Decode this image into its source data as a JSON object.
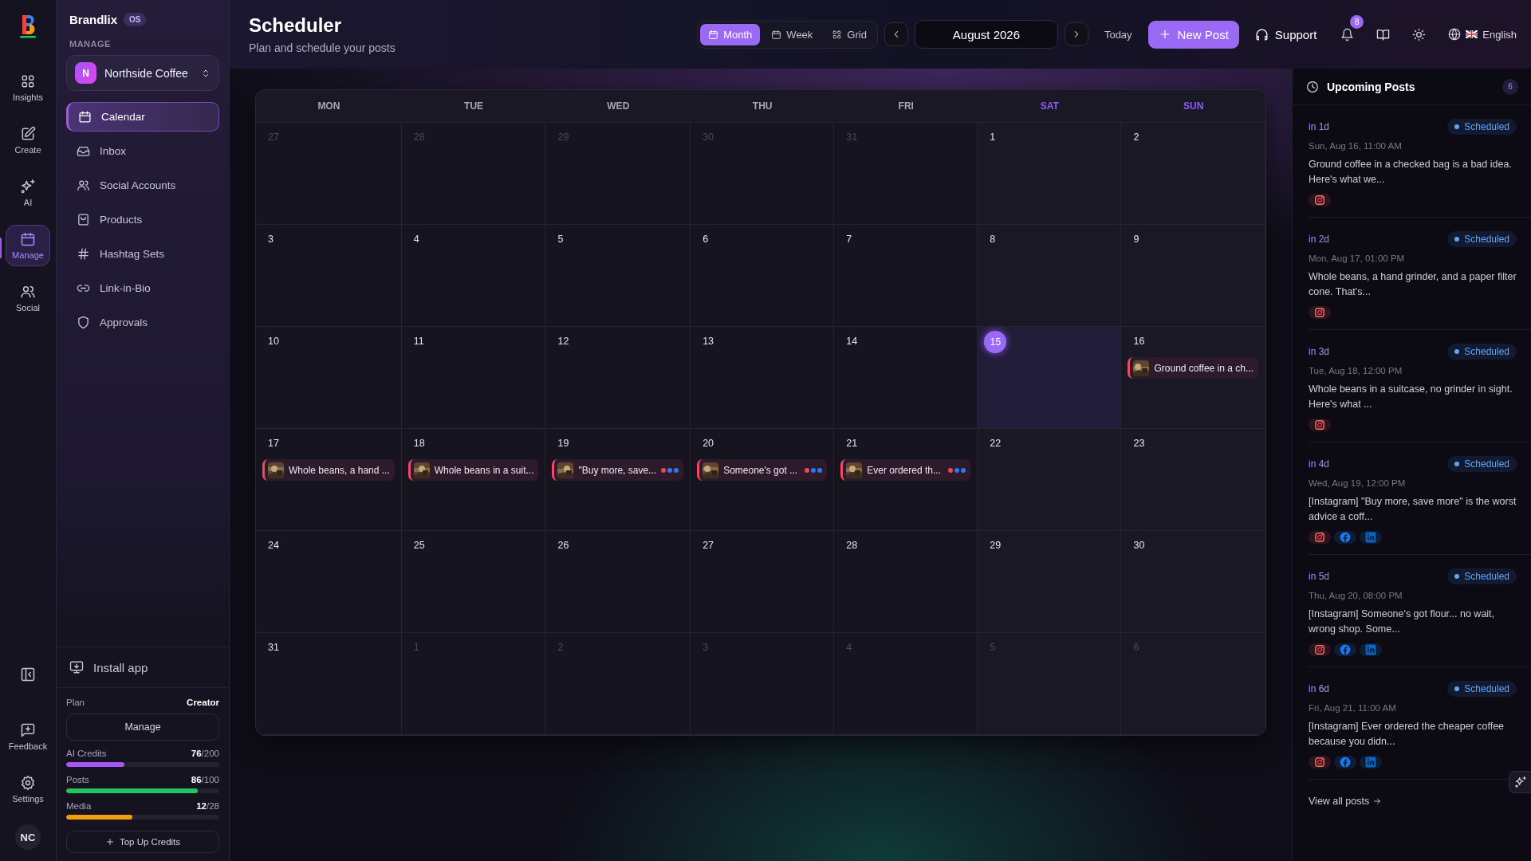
{
  "rail": {
    "items": [
      {
        "label": "Insights",
        "selected": false
      },
      {
        "label": "Create",
        "selected": false
      },
      {
        "label": "AI",
        "selected": false
      },
      {
        "label": "Manage",
        "selected": true
      },
      {
        "label": "Social",
        "selected": false
      }
    ],
    "footer": [
      {
        "label": "Feedback"
      },
      {
        "label": "Settings"
      }
    ],
    "avatar": "NC"
  },
  "sidebar": {
    "brand": "Brandlix",
    "brand_badge": "OS",
    "section": "MANAGE",
    "workspace": {
      "initial": "N",
      "name": "Northside Coffee"
    },
    "items": [
      {
        "label": "Calendar",
        "selected": true
      },
      {
        "label": "Inbox",
        "selected": false
      },
      {
        "label": "Social Accounts",
        "selected": false
      },
      {
        "label": "Products",
        "selected": false
      },
      {
        "label": "Hashtag Sets",
        "selected": false
      },
      {
        "label": "Link-in-Bio",
        "selected": false
      },
      {
        "label": "Approvals",
        "selected": false
      }
    ],
    "install": "Install app",
    "plan_label": "Plan",
    "plan": "Creator",
    "manage_button": "Manage",
    "usage": [
      {
        "label": "AI Credits",
        "reading": "**76**/200",
        "level": 0.38,
        "color": "#a855f7"
      },
      {
        "label": "Posts",
        "reading": "**86**/100",
        "level": 0.86,
        "color": "#22c55e"
      },
      {
        "label": "Media",
        "reading": "**12**/28",
        "level": 0.43,
        "color": "#f59e0b"
      }
    ],
    "top_up": "Top Up Credits"
  },
  "header": {
    "title": "Scheduler",
    "subtitle": "Plan and schedule your posts",
    "views": [
      {
        "label": "Month",
        "selected": true
      },
      {
        "label": "Week",
        "selected": false
      },
      {
        "label": "Grid",
        "selected": false
      }
    ],
    "period": "August 2026",
    "today": "Today",
    "new_post": "New Post",
    "support": "Support",
    "notifications": "8",
    "language": "English"
  },
  "calendar": {
    "weekdays": [
      {
        "label": "MON",
        "weekend": false
      },
      {
        "label": "TUE",
        "weekend": false
      },
      {
        "label": "WED",
        "weekend": false
      },
      {
        "label": "THU",
        "weekend": false
      },
      {
        "label": "FRI",
        "weekend": false
      },
      {
        "label": "SAT",
        "weekend": true
      },
      {
        "label": "SUN",
        "weekend": true
      }
    ],
    "weeks": [
      [
        {
          "day": "27",
          "in_month": false
        },
        {
          "day": "28",
          "in_month": false
        },
        {
          "day": "29",
          "in_month": false
        },
        {
          "day": "30",
          "in_month": false
        },
        {
          "day": "31",
          "in_month": false
        },
        {
          "day": "1",
          "in_month": true
        },
        {
          "day": "2",
          "in_month": true
        }
      ],
      [
        {
          "day": "3",
          "in_month": true
        },
        {
          "day": "4",
          "in_month": true
        },
        {
          "day": "5",
          "in_month": true
        },
        {
          "day": "6",
          "in_month": true
        },
        {
          "day": "7",
          "in_month": true
        },
        {
          "day": "8",
          "in_month": true
        },
        {
          "day": "9",
          "in_month": true
        }
      ],
      [
        {
          "day": "10",
          "in_month": true
        },
        {
          "day": "11",
          "in_month": true
        },
        {
          "day": "12",
          "in_month": true
        },
        {
          "day": "13",
          "in_month": true
        },
        {
          "day": "14",
          "in_month": true
        },
        {
          "day": "15",
          "in_month": true,
          "today": true
        },
        {
          "day": "16",
          "in_month": true,
          "posts": [
            {
              "text": "Ground coffee in a ch..."
            }
          ]
        }
      ],
      [
        {
          "day": "17",
          "in_month": true,
          "posts": [
            {
              "text": "Whole beans, a hand ..."
            }
          ]
        },
        {
          "day": "18",
          "in_month": true,
          "posts": [
            {
              "text": "Whole beans in a suit..."
            }
          ]
        },
        {
          "day": "19",
          "in_month": true,
          "posts": [
            {
              "text": "\"Buy more, save...",
              "dots": [
                {
                  "color": "#f0445a"
                },
                {
                  "color": "#2b7bf0"
                },
                {
                  "color": "#2b7bf0"
                }
              ]
            }
          ]
        },
        {
          "day": "20",
          "in_month": true,
          "posts": [
            {
              "text": "Someone's got ...",
              "dots": [
                {
                  "color": "#f0445a"
                },
                {
                  "color": "#2b7bf0"
                },
                {
                  "color": "#2b7bf0"
                }
              ]
            }
          ]
        },
        {
          "day": "21",
          "in_month": true,
          "posts": [
            {
              "text": "Ever ordered th...",
              "dots": [
                {
                  "color": "#f0445a"
                },
                {
                  "color": "#2b7bf0"
                },
                {
                  "color": "#2b7bf0"
                }
              ]
            }
          ]
        },
        {
          "day": "22",
          "in_month": true
        },
        {
          "day": "23",
          "in_month": true
        }
      ],
      [
        {
          "day": "24",
          "in_month": true
        },
        {
          "day": "25",
          "in_month": true
        },
        {
          "day": "26",
          "in_month": true
        },
        {
          "day": "27",
          "in_month": true
        },
        {
          "day": "28",
          "in_month": true
        },
        {
          "day": "29",
          "in_month": true
        },
        {
          "day": "30",
          "in_month": true
        }
      ],
      [
        {
          "day": "31",
          "in_month": true
        },
        {
          "day": "1",
          "in_month": false
        },
        {
          "day": "2",
          "in_month": false
        },
        {
          "day": "3",
          "in_month": false
        },
        {
          "day": "4",
          "in_month": false
        },
        {
          "day": "5",
          "in_month": false
        },
        {
          "day": "6",
          "in_month": false
        }
      ]
    ]
  },
  "upcoming": {
    "title": "Upcoming Posts",
    "count": "6",
    "posts": [
      {
        "relative": "in 1d",
        "status": "Scheduled",
        "date": "Sun, Aug 16, 11:00 AM",
        "text": "Ground coffee in a checked bag is a bad idea. Here's what we...",
        "platforms": [
          {
            "kind": "instagram"
          }
        ]
      },
      {
        "relative": "in 2d",
        "status": "Scheduled",
        "date": "Mon, Aug 17, 01:00 PM",
        "text": "Whole beans, a hand grinder, and a paper filter cone. That's...",
        "platforms": [
          {
            "kind": "instagram"
          }
        ]
      },
      {
        "relative": "in 3d",
        "status": "Scheduled",
        "date": "Tue, Aug 18, 12:00 PM",
        "text": "Whole beans in a suitcase, no grinder in sight. Here's what ...",
        "platforms": [
          {
            "kind": "instagram"
          }
        ]
      },
      {
        "relative": "in 4d",
        "status": "Scheduled",
        "date": "Wed, Aug 19, 12:00 PM",
        "text": "[Instagram] \"Buy more, save more\" is the worst advice a coff...",
        "platforms": [
          {
            "kind": "instagram"
          },
          {
            "kind": "facebook"
          },
          {
            "kind": "linkedin"
          }
        ]
      },
      {
        "relative": "in 5d",
        "status": "Scheduled",
        "date": "Thu, Aug 20, 08:00 PM",
        "text": "[Instagram] Someone's got flour... no wait, wrong shop. Some...",
        "platforms": [
          {
            "kind": "instagram"
          },
          {
            "kind": "facebook"
          },
          {
            "kind": "linkedin"
          }
        ]
      },
      {
        "relative": "in 6d",
        "status": "Scheduled",
        "date": "Fri, Aug 21, 11:00 AM",
        "text": "[Instagram] Ever ordered the cheaper coffee because you didn...",
        "platforms": [
          {
            "kind": "instagram"
          },
          {
            "kind": "facebook"
          },
          {
            "kind": "linkedin"
          }
        ]
      }
    ],
    "view_all": "View all posts"
  }
}
